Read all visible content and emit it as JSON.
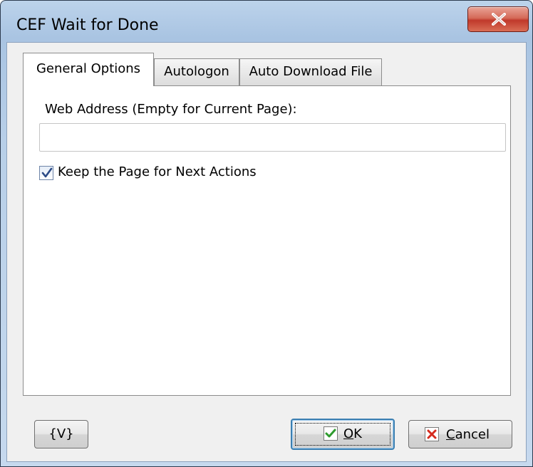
{
  "window": {
    "title": "CEF Wait for Done",
    "close_symbol": "×"
  },
  "tabs": [
    {
      "label": "General Options",
      "active": true
    },
    {
      "label": "Autologon",
      "active": false
    },
    {
      "label": "Auto Download File",
      "active": false
    }
  ],
  "general_options": {
    "web_address_label": "Web Address (Empty for Current Page):",
    "web_address_value": "",
    "keep_page_label": "Keep the Page for Next Actions",
    "keep_page_checked": true
  },
  "buttons": {
    "variables_label": "{V}",
    "ok_label_mnemonic": "O",
    "ok_label_rest": "K",
    "cancel_label_mnemonic": "C",
    "cancel_label_rest": "ancel"
  },
  "icons": {
    "close": "close-icon",
    "checkbox_check": "checkmark-icon",
    "ok": "green-check-icon",
    "cancel": "red-x-icon"
  },
  "colors": {
    "ok_check": "#2e9b2e",
    "cancel_x": "#d52b1e",
    "close_button": "#c0392b"
  }
}
